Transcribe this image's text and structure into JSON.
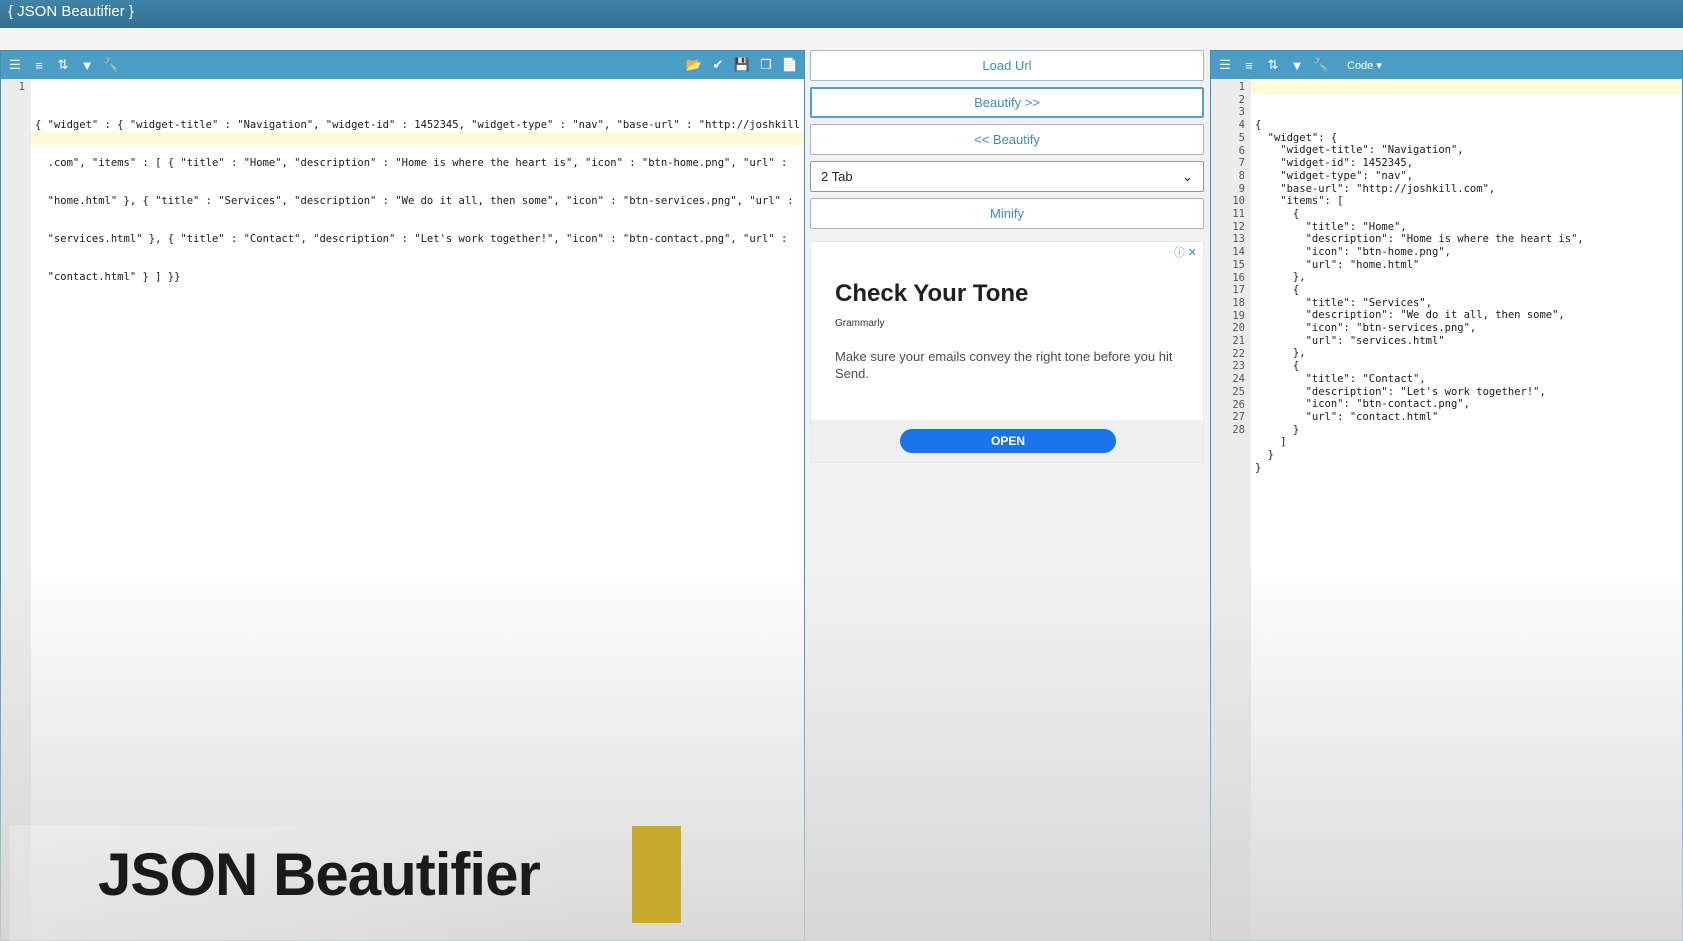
{
  "app": {
    "title": "{ JSON Beautifier }"
  },
  "left_panel": {
    "toolbar_icons": [
      "indent-icon",
      "align-icon",
      "sort-icon",
      "filter-icon",
      "wrench-icon"
    ],
    "toolbar_right_icons": [
      "open-file-icon",
      "clean-icon",
      "save-icon",
      "copy-icon",
      "document-icon"
    ],
    "line_numbers": [
      "1"
    ],
    "lines": [
      "{ \"widget\" : { \"widget-title\" : \"Navigation\", \"widget-id\" : 1452345, \"widget-type\" : \"nav\", \"base-url\" : \"http://joshkill",
      "  .com\", \"items\" : [ { \"title\" : \"Home\", \"description\" : \"Home is where the heart is\", \"icon\" : \"btn-home.png\", \"url\" :",
      "  \"home.html\" }, { \"title\" : \"Services\", \"description\" : \"We do it all, then some\", \"icon\" : \"btn-services.png\", \"url\" :",
      "  \"services.html\" }, { \"title\" : \"Contact\", \"description\" : \"Let's work together!\", \"icon\" : \"btn-contact.png\", \"url\" :",
      "  \"contact.html\" } ] }}"
    ]
  },
  "middle": {
    "load_url": "Load Url",
    "beautify_right": "Beautify >>",
    "beautify_left": "<< Beautify",
    "indent_select": "2 Tab",
    "minify": "Minify"
  },
  "ad": {
    "title": "Check Your Tone",
    "brand": "Grammarly",
    "body": "Make sure your emails convey the right tone before you hit Send.",
    "cta": "OPEN",
    "close": "ⓘ ✕"
  },
  "right_panel": {
    "code_menu": "Code ▾",
    "line_numbers": [
      "1",
      "2",
      "3",
      "4",
      "5",
      "6",
      "7",
      "8",
      "9",
      "10",
      "11",
      "12",
      "13",
      "14",
      "15",
      "16",
      "17",
      "18",
      "19",
      "20",
      "21",
      "22",
      "23",
      "24",
      "25",
      "26",
      "27",
      "28"
    ],
    "lines": [
      "{",
      "  \"widget\": {",
      "    \"widget-title\": \"Navigation\",",
      "    \"widget-id\": 1452345,",
      "    \"widget-type\": \"nav\",",
      "    \"base-url\": \"http://joshkill.com\",",
      "    \"items\": [",
      "      {",
      "        \"title\": \"Home\",",
      "        \"description\": \"Home is where the heart is\",",
      "        \"icon\": \"btn-home.png\",",
      "        \"url\": \"home.html\"",
      "      },",
      "      {",
      "        \"title\": \"Services\",",
      "        \"description\": \"We do it all, then some\",",
      "        \"icon\": \"btn-services.png\",",
      "        \"url\": \"services.html\"",
      "      },",
      "      {",
      "        \"title\": \"Contact\",",
      "        \"description\": \"Let's work together!\",",
      "        \"icon\": \"btn-contact.png\",",
      "        \"url\": \"contact.html\"",
      "      }",
      "    ]",
      "  }",
      "}"
    ]
  },
  "overlay": {
    "caption": "JSON Beautifier",
    "accent_color": "#c9a92a"
  }
}
